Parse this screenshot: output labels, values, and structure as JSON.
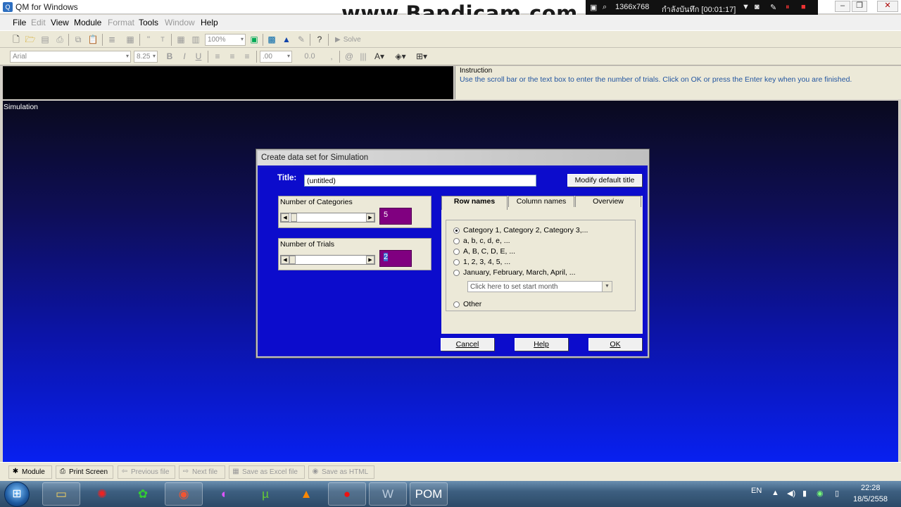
{
  "app": {
    "title": "QM for Windows"
  },
  "watermark": {
    "text": "www.Bandicam.com"
  },
  "recorder": {
    "resolution": "1366x768",
    "status": "กำลังบันทึก [00:01:17]"
  },
  "menu": [
    {
      "label": "File",
      "disabled": false
    },
    {
      "label": "Edit",
      "disabled": true
    },
    {
      "label": "View",
      "disabled": false
    },
    {
      "label": "Module",
      "disabled": false
    },
    {
      "label": "Format",
      "disabled": true
    },
    {
      "label": "Tools",
      "disabled": false
    },
    {
      "label": "Window",
      "disabled": true
    },
    {
      "label": "Help",
      "disabled": false
    }
  ],
  "toolbar": {
    "zoom": "100%",
    "solve_label": "Solve",
    "font": "Arial",
    "font_size": "8.25",
    "decimals": ".00",
    "number_format": "0.0"
  },
  "instruction": {
    "title": "Instruction",
    "text": "Use the scroll bar or the text box to enter the number of trials. Click on OK or press the Enter key when you are finished."
  },
  "workspace": {
    "label": "Simulation"
  },
  "dialog": {
    "title": "Create data set for Simulation",
    "title_label": "Title:",
    "title_value": "(untitled)",
    "modify_title_button": "Modify default title",
    "categories": {
      "label": "Number of Categories",
      "value": "5"
    },
    "trials": {
      "label": "Number of Trials",
      "value": "2"
    },
    "tabs": [
      "Row names",
      "Column names",
      "Overview"
    ],
    "row_name_options": [
      {
        "label": "Category 1, Category 2, Category 3,...",
        "checked": true
      },
      {
        "label": "a, b, c, d, e, ...",
        "checked": false
      },
      {
        "label": "A, B, C, D, E, ...",
        "checked": false
      },
      {
        "label": "1, 2, 3, 4, 5, ...",
        "checked": false
      },
      {
        "label": "January, February, March, April, ...",
        "checked": false
      }
    ],
    "month_placeholder": "Click here to set start month",
    "other_label": "Other",
    "cancel_button": "Cancel",
    "help_button": "Help",
    "ok_button": "OK"
  },
  "statusbar": [
    {
      "label": "Module",
      "disabled": false
    },
    {
      "label": "Print Screen",
      "disabled": false
    },
    {
      "label": "Previous file",
      "disabled": true
    },
    {
      "label": "Next file",
      "disabled": true
    },
    {
      "label": "Save as Excel file",
      "disabled": true
    },
    {
      "label": "Save as HTML",
      "disabled": true
    }
  ],
  "taskbar": {
    "language": "EN",
    "time": "22:28",
    "date": "18/5/2558"
  }
}
